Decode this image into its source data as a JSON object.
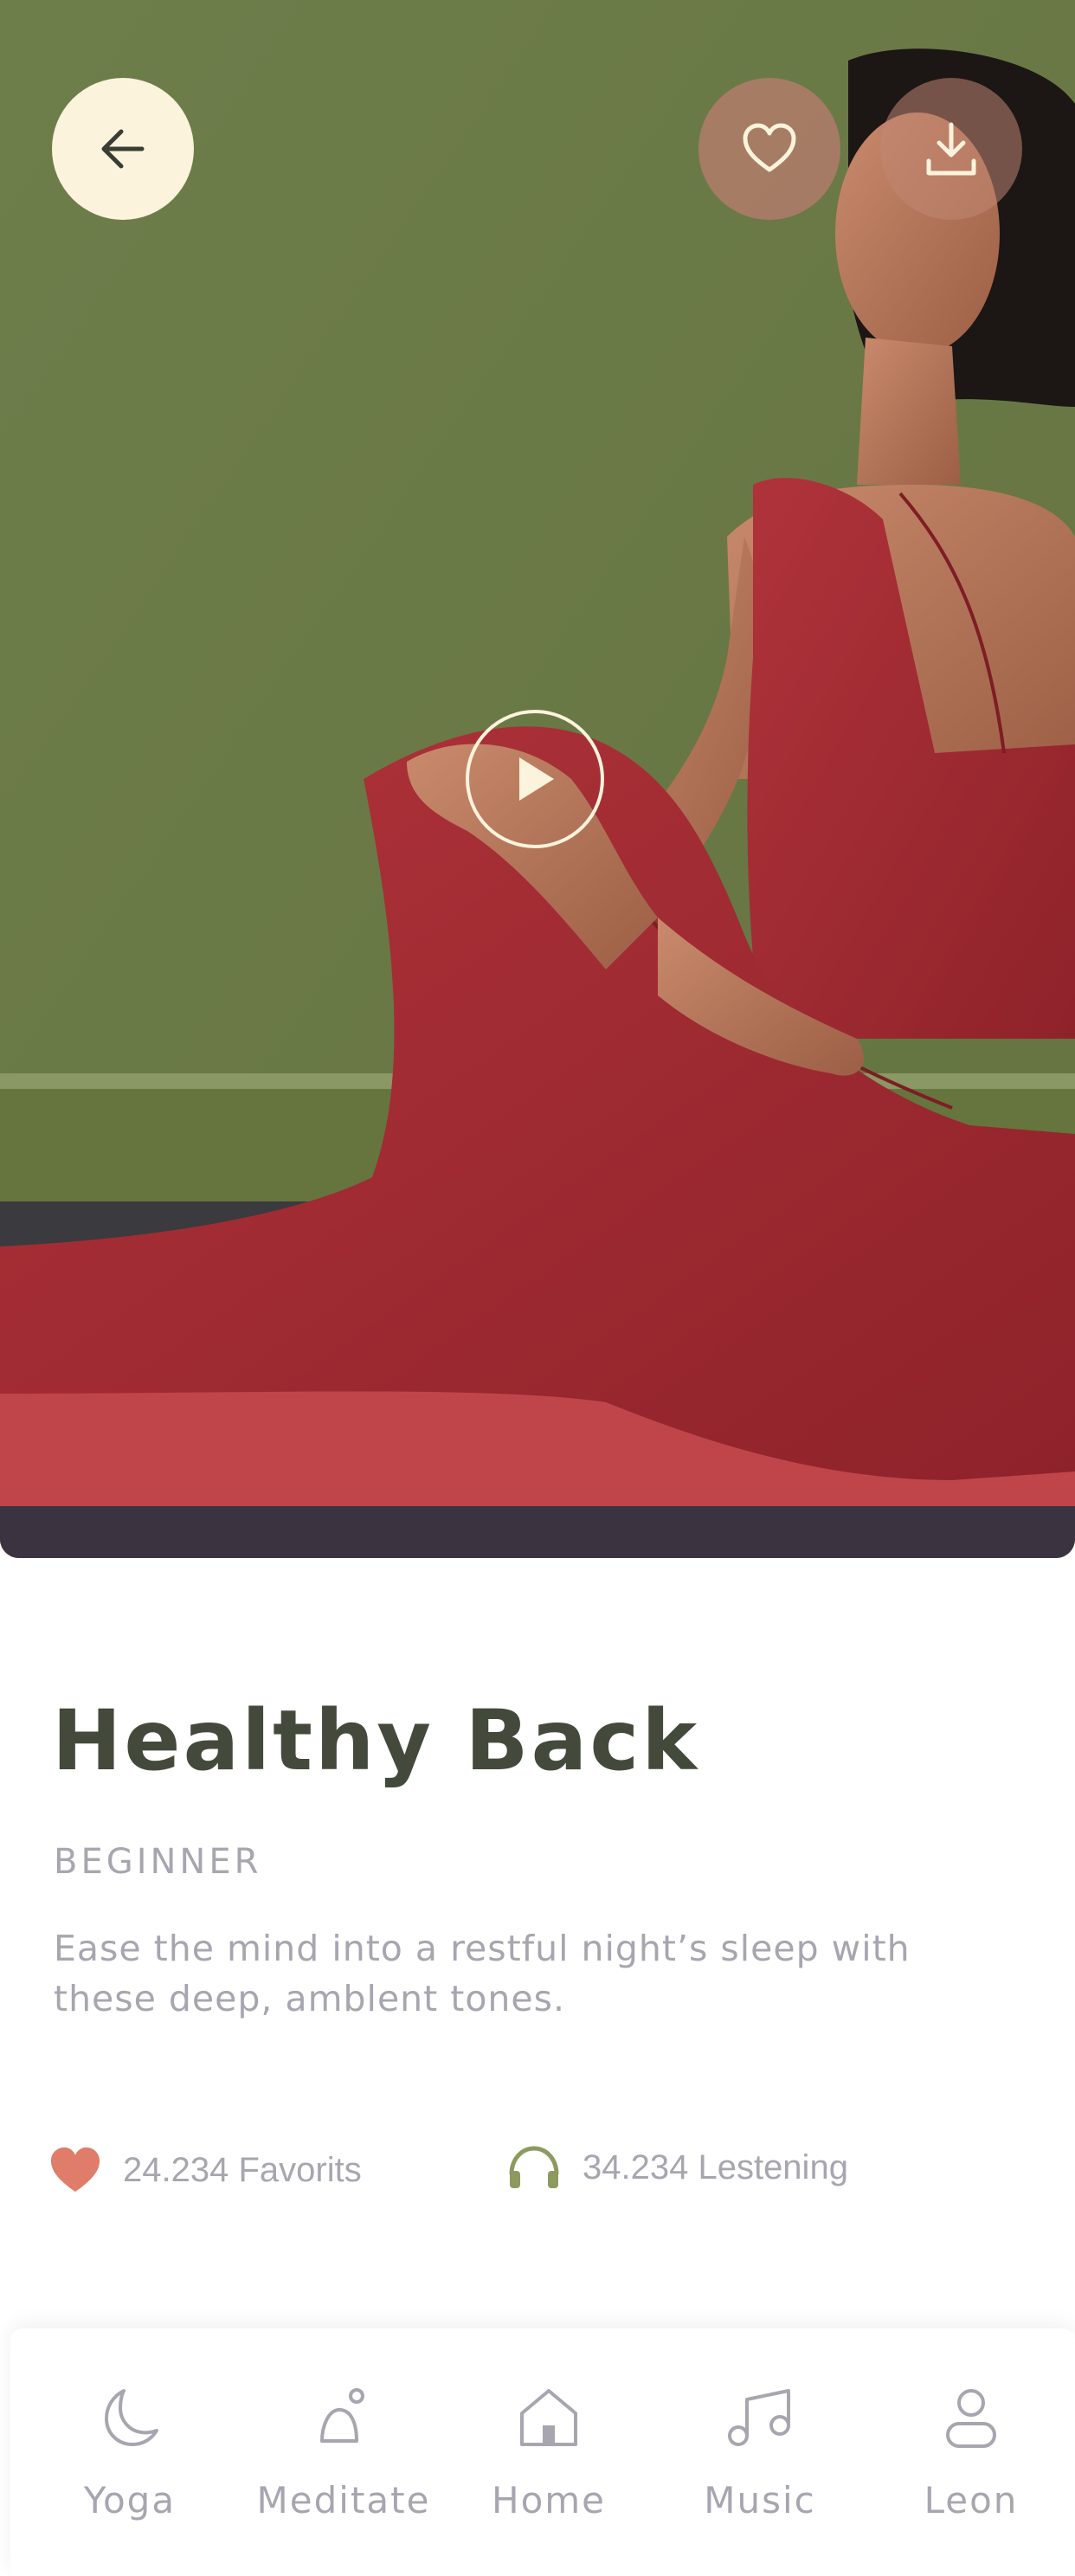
{
  "hero": {
    "image": "woman-in-red-yoga-suit-seated-twist",
    "back_icon": "arrow-left-icon",
    "favorite_icon": "heart-outline-icon",
    "download_icon": "download-icon",
    "play_icon": "play-icon"
  },
  "session": {
    "title": "Healthy Back",
    "level": "BEGINNER",
    "description": "Ease the mind into a restful night’s sleep  with these deep, amblent tones."
  },
  "stats": {
    "favorites": {
      "icon": "heart-filled-icon",
      "text": "24.234 Favorits"
    },
    "listening": {
      "icon": "headphones-icon",
      "text": "34.234 Lestening"
    }
  },
  "tabs": [
    {
      "label": "Yoga",
      "icon": "moon-icon"
    },
    {
      "label": "Meditate",
      "icon": "meditate-icon"
    },
    {
      "label": "Home",
      "icon": "home-icon"
    },
    {
      "label": "Music",
      "icon": "music-note-icon"
    },
    {
      "label": "Leon",
      "icon": "user-icon"
    }
  ],
  "colors": {
    "title": "#434a3b",
    "muted": "#a7a6b0",
    "heart": "#e07c6a",
    "headphones": "#8c9a5f",
    "cream": "#fbf3dc"
  }
}
